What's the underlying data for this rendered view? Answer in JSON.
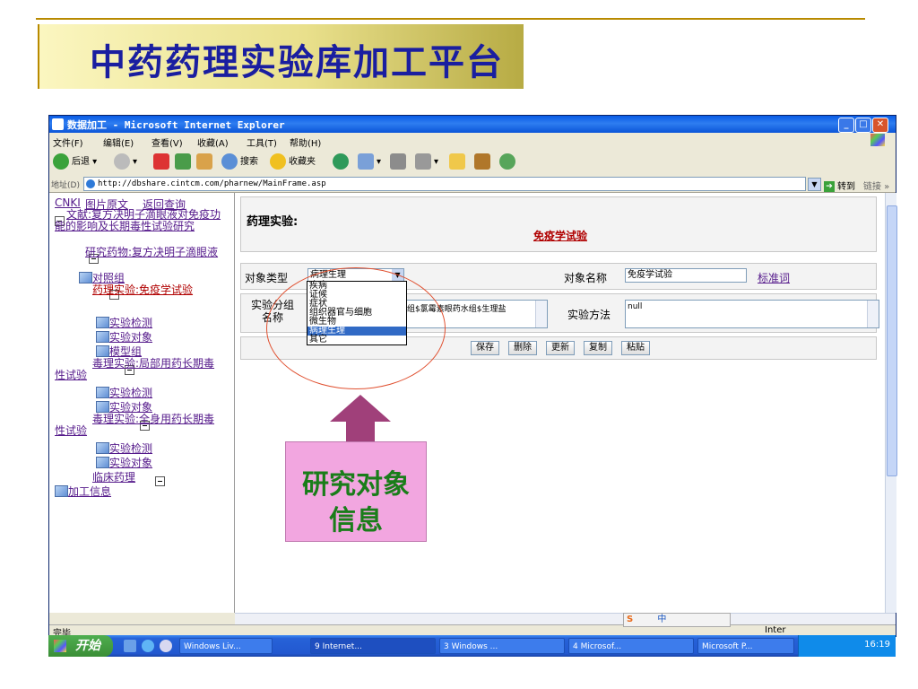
{
  "slide": {
    "title": "中药药理实验库加工平台"
  },
  "window": {
    "title": "数据加工 - Microsoft Internet Explorer",
    "menus": [
      "文件(F)",
      "编辑(E)",
      "查看(V)",
      "收藏(A)",
      "工具(T)",
      "帮助(H)"
    ],
    "toolbar": {
      "back": "后退",
      "search": "搜索",
      "favorites": "收藏夹"
    },
    "address_label": "地址(D)",
    "address": "http://dbshare.cintcm.com/pharnew/MainFrame.asp",
    "go": "转到",
    "links": "链接",
    "status": "完毕"
  },
  "tree": {
    "top_links": [
      "CNKI",
      "图片原文",
      "返回查询"
    ],
    "literature": "文献:复方决明子滴眼液对免疫功能的影响及长期毒性试验研究",
    "drug": "研究药物:复方决明子滴眼液",
    "control": "对照组",
    "exp1": "药理实验:免疫学试验",
    "exp1_children": [
      "实验检测",
      "实验对象",
      "模型组"
    ],
    "exp2": "毒理实验:局部用药长期毒性试验",
    "exp2_children": [
      "实验检测",
      "实验对象"
    ],
    "exp3": "毒理实验:全身用药长期毒性试验",
    "exp3_children": [
      "实验检测",
      "实验对象"
    ],
    "clinical": "临床药理",
    "processing": "加工信息"
  },
  "form": {
    "heading": "药理实验:",
    "subtitle": "免疫学试验",
    "object_type_label": "对象类型",
    "object_type_value": "病理生理",
    "object_type_options": [
      "疾病",
      "证候",
      "症状",
      "组织器官与细胞",
      "微生物",
      "病理生理",
      "其它"
    ],
    "object_type_selected_index": 5,
    "object_name_label": "对象名称",
    "object_name_value": "免疫学试验",
    "standard_term": "标准词",
    "group_label": "实验分组名称",
    "group_value": "组$氯霉素眼药水组$生理盐",
    "method_label": "实验方法",
    "method_value": "null",
    "buttons": [
      "保存",
      "删除",
      "更新",
      "复制",
      "粘贴"
    ]
  },
  "taskbar": {
    "start": "开始",
    "tasks": [
      "Windows Liv...",
      "9 Internet...",
      "3 Windows ...",
      "4 Microsof...",
      "Microsoft P..."
    ],
    "ime": "中",
    "tray_text": "Inter",
    "clock": "16:19"
  },
  "callout": {
    "text": "研究对象信息",
    "line1": "研究对象",
    "line2": "信息"
  },
  "colors": {
    "title_blue": "#1a1ea0",
    "link_purple": "#551a8b",
    "red": "#b00000",
    "callout_green": "#1a7d1a",
    "arrow_purple": "#a0407a"
  }
}
